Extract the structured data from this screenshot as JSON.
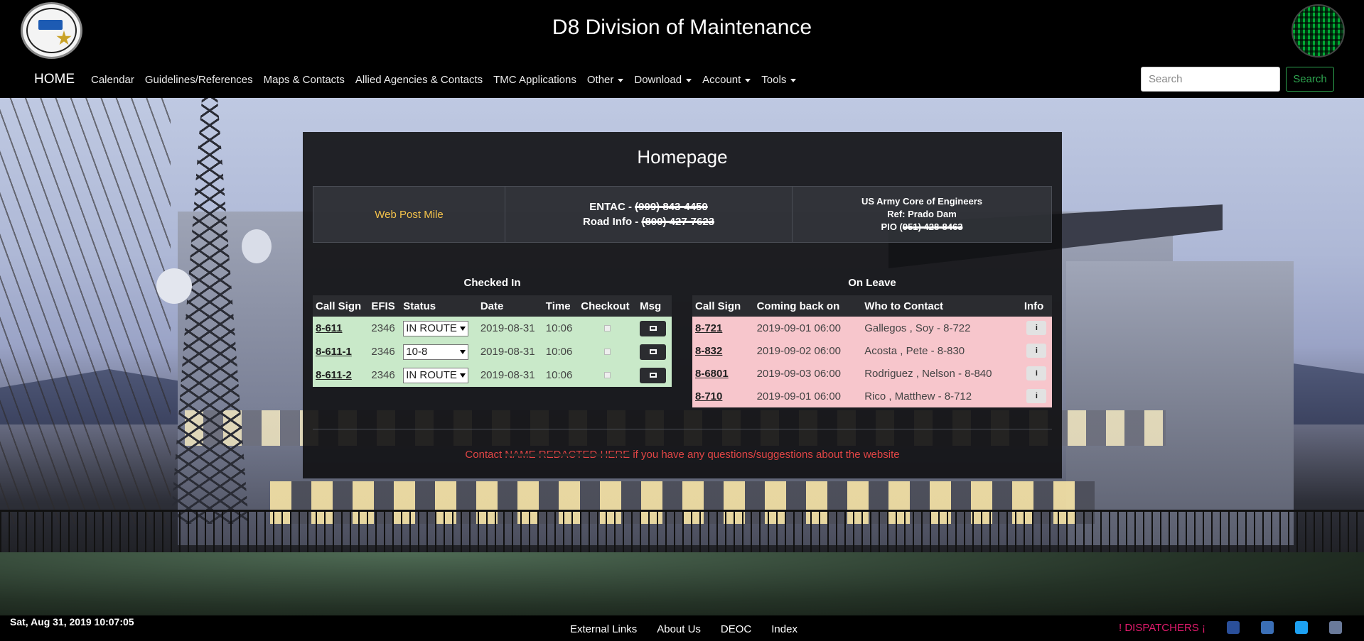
{
  "header": {
    "title": "D8 Division of Maintenance",
    "home_label": "HOME",
    "nav": [
      {
        "label": "Calendar",
        "dropdown": false
      },
      {
        "label": "Guidelines/References",
        "dropdown": false
      },
      {
        "label": "Maps & Contacts",
        "dropdown": false
      },
      {
        "label": "Allied Agencies & Contacts",
        "dropdown": false
      },
      {
        "label": "TMC Applications",
        "dropdown": false
      },
      {
        "label": "Other",
        "dropdown": true
      },
      {
        "label": "Download",
        "dropdown": true
      },
      {
        "label": "Account",
        "dropdown": true
      },
      {
        "label": "Tools",
        "dropdown": true
      }
    ],
    "search_placeholder": "Search",
    "search_button": "Search",
    "logo_left_text": "INLAND EMPIRE TMC CALIFORNIA HIGHWAY PATROL DISTRICT 8 / INLAND DIVISION"
  },
  "panel": {
    "title": "Homepage",
    "info": {
      "web_post_mile": "Web Post Mile",
      "entac_label": "ENTAC - ",
      "entac_value": "(909) 843-4450",
      "road_label": "Road Info - ",
      "road_value": "(800) 427-7623",
      "army_line1": "US Army Core of Engineers",
      "army_line2": "Ref: Prado Dam",
      "pio_label": "PIO (",
      "pio_value": "951) 428-8463"
    },
    "checked_in": {
      "caption": "Checked In",
      "headers": [
        "Call Sign",
        "EFIS",
        "Status",
        "Date",
        "Time",
        "Checkout",
        "Msg"
      ],
      "rows": [
        {
          "call_sign": "8-611",
          "efis": "2346",
          "status": "IN ROUTE",
          "date": "2019-08-31",
          "time": "10:06"
        },
        {
          "call_sign": "8-611-1",
          "efis": "2346",
          "status": "10-8",
          "date": "2019-08-31",
          "time": "10:06"
        },
        {
          "call_sign": "8-611-2",
          "efis": "2346",
          "status": "IN ROUTE",
          "date": "2019-08-31",
          "time": "10:06"
        }
      ]
    },
    "on_leave": {
      "caption": "On Leave",
      "headers": [
        "Call Sign",
        "Coming back on",
        "Who to Contact",
        "Info"
      ],
      "rows": [
        {
          "call_sign": "8-721",
          "back": "2019-09-01 06:00",
          "contact": "Gallegos , Soy - 8-722"
        },
        {
          "call_sign": "8-832",
          "back": "2019-09-02 06:00",
          "contact": "Acosta , Pete - 8-830"
        },
        {
          "call_sign": "8-6801",
          "back": "2019-09-03 06:00",
          "contact": "Rodriguez , Nelson - 8-840"
        },
        {
          "call_sign": "8-710",
          "back": "2019-09-01 06:00",
          "contact": "Rico , Matthew - 8-712"
        }
      ]
    },
    "contact_prefix": "Contact ",
    "contact_name": "NAME REDACTED HERE",
    "contact_suffix": " if you have any questions/suggestions about the website"
  },
  "footer": {
    "datetime": "Sat, Aug 31, 2019 10:07:05",
    "links": [
      "External Links",
      "About Us",
      "DEOC",
      "Index"
    ],
    "dispatchers": "! DISPATCHERS ¡"
  },
  "colors": {
    "accent_green": "#2ea44f",
    "web_post_mile": "#f3c24b",
    "checked_in_row": "#c9e9c9",
    "on_leave_row": "#f7c6cc",
    "contact_text": "#e04545",
    "dispatchers": "#e21b6d"
  }
}
